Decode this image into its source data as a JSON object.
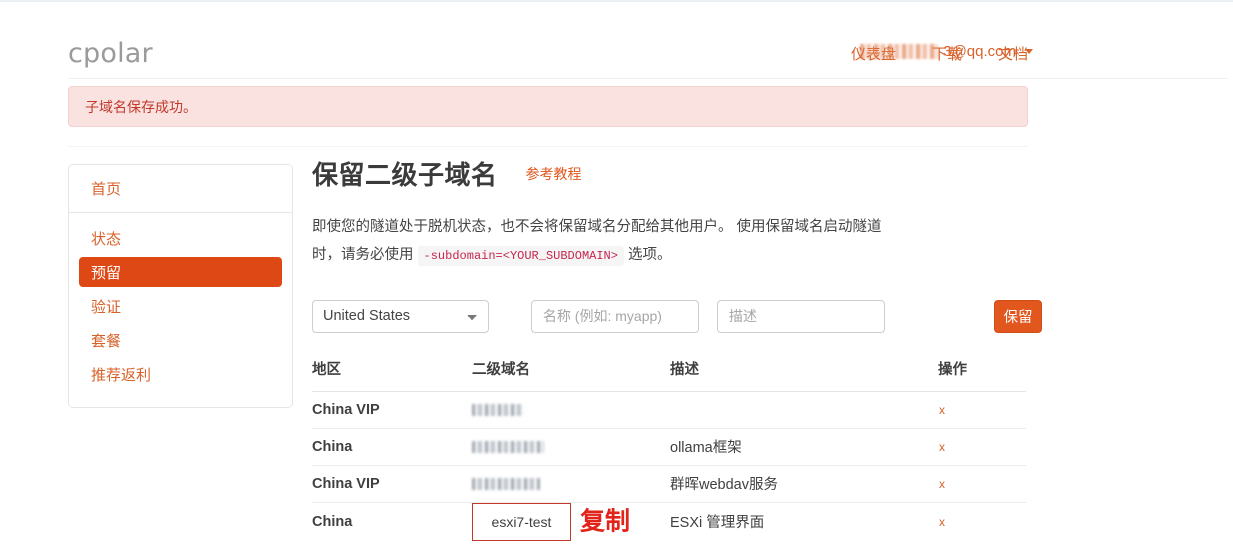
{
  "header": {
    "brand": "cpolar",
    "nav": [
      {
        "label": "仪表盘"
      },
      {
        "label": "下载"
      },
      {
        "label": "文档"
      }
    ],
    "account": {
      "email_suffix": "3@qq.com",
      "redacted": true
    }
  },
  "alert": {
    "message": "子域名保存成功。",
    "type": "success-pink",
    "bg_color": "#f9e2e0",
    "text_color": "#c0392b"
  },
  "sidebar": {
    "home": {
      "label": "首页"
    },
    "items": [
      {
        "label": "状态",
        "active": false
      },
      {
        "label": "预留",
        "active": true
      },
      {
        "label": "验证",
        "active": false
      },
      {
        "label": "套餐",
        "active": false
      },
      {
        "label": "推荐返利",
        "active": false
      }
    ],
    "active_bg": "#dd4814",
    "link_color": "#d9622b"
  },
  "main": {
    "title": "保留二级子域名",
    "tutorial_link": "参考教程",
    "description_part1": "即使您的隧道处于脱机状态，也不会将保留域名分配给其他用户。 使用保留域名启动隧道时，请务必使用",
    "description_code": "-subdomain=<YOUR_SUBDOMAIN>",
    "description_part2": "选项。",
    "form": {
      "region_selected": "United States",
      "region_options": [
        "United States"
      ],
      "name_placeholder": "名称 (例如: myapp)",
      "name_value": "",
      "desc_placeholder": "描述",
      "desc_value": "",
      "save_label": "保留"
    },
    "table": {
      "columns": [
        "地区",
        "二级域名",
        "描述",
        "操作"
      ],
      "rows": [
        {
          "region": "China VIP",
          "domain": "",
          "domain_redacted": true,
          "domain_width": 52,
          "description": "",
          "action": "x"
        },
        {
          "region": "China",
          "domain": "",
          "domain_redacted": true,
          "domain_width": 72,
          "description": "ollama框架",
          "action": "x"
        },
        {
          "region": "China VIP",
          "domain": "",
          "domain_redacted": true,
          "domain_width": 68,
          "description": "群晖webdav服务",
          "action": "x"
        },
        {
          "region": "China",
          "domain": "esxi7-test",
          "domain_redacted": false,
          "domain_width": 0,
          "description": "ESXi 管理界面",
          "action": "x",
          "highlighted": true,
          "annotation": "复制"
        }
      ]
    }
  }
}
